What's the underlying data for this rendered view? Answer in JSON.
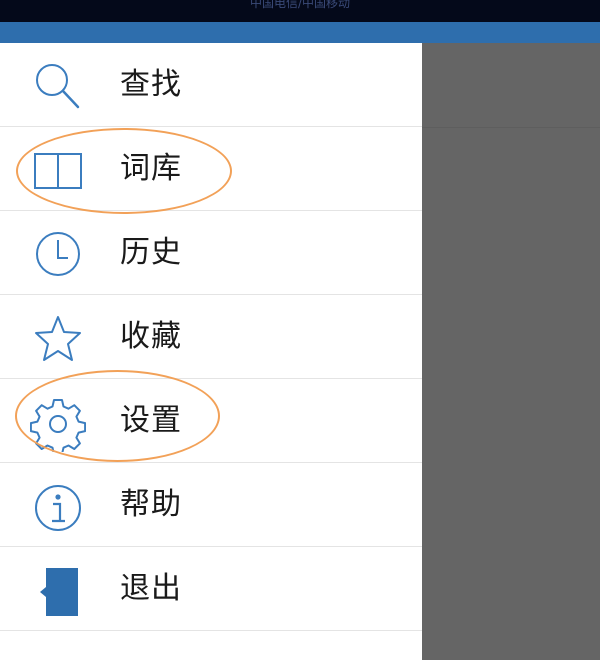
{
  "status_bar": {
    "carrier_text": "中国电信/中国移动"
  },
  "colors": {
    "status_bar_bg": "#04091a",
    "header": "#2e6ead",
    "icon": "#3b7dbf",
    "overlay": "#656565",
    "annotation": "#f2a158"
  },
  "menu": {
    "items": [
      {
        "label": "查找",
        "icon": "search-icon"
      },
      {
        "label": "词库",
        "icon": "book-icon"
      },
      {
        "label": "历史",
        "icon": "clock-icon"
      },
      {
        "label": "收藏",
        "icon": "star-icon"
      },
      {
        "label": "设置",
        "icon": "gear-icon"
      },
      {
        "label": "帮助",
        "icon": "info-icon"
      },
      {
        "label": "退出",
        "icon": "exit-door-icon"
      }
    ]
  }
}
